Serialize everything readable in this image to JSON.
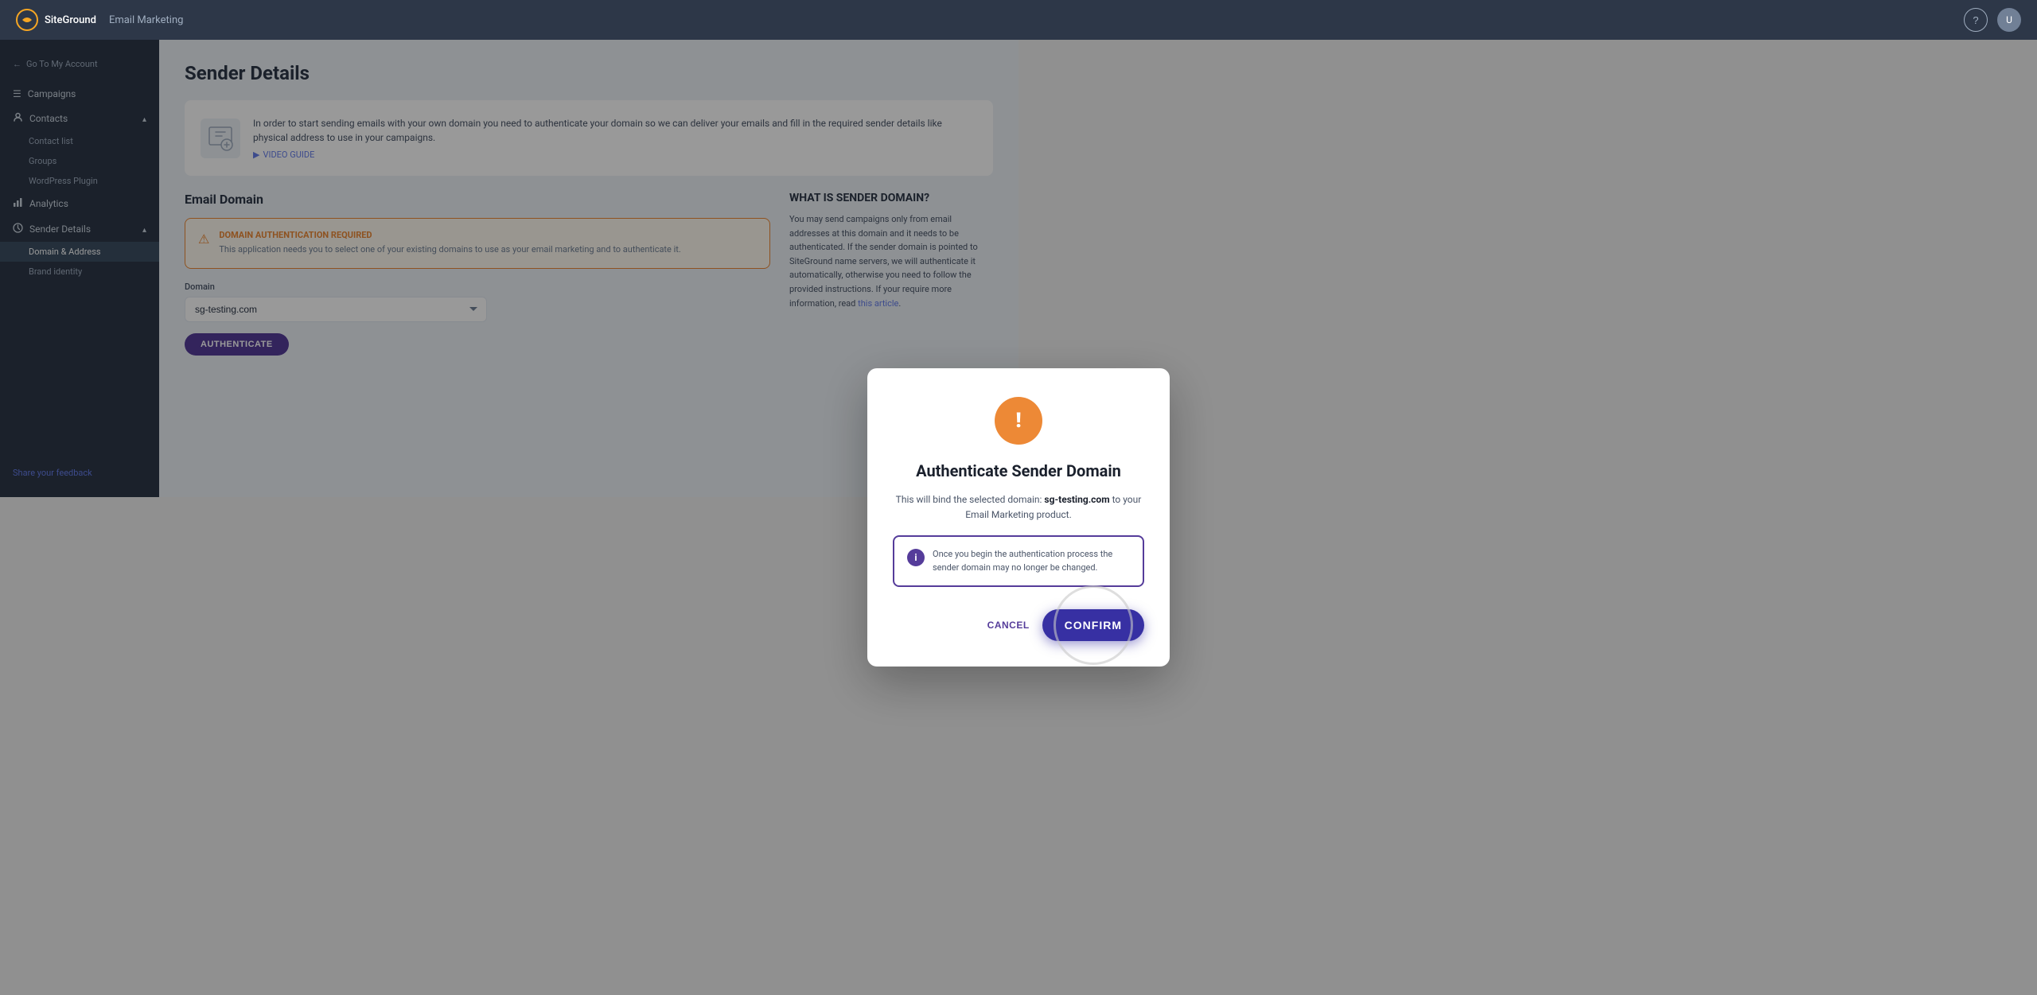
{
  "topnav": {
    "logo_text": "SiteGround",
    "product_title": "Email Marketing",
    "help_label": "?",
    "avatar_label": "U"
  },
  "sidebar": {
    "go_to_account": "Go To My Account",
    "items": [
      {
        "id": "campaigns",
        "label": "Campaigns",
        "icon": "campaigns-icon"
      },
      {
        "id": "contacts",
        "label": "Contacts",
        "icon": "contacts-icon",
        "expanded": true,
        "children": [
          {
            "id": "contact-list",
            "label": "Contact list"
          },
          {
            "id": "groups",
            "label": "Groups"
          },
          {
            "id": "wordpress-plugin",
            "label": "WordPress Plugin"
          }
        ]
      },
      {
        "id": "analytics",
        "label": "Analytics",
        "icon": "analytics-icon"
      },
      {
        "id": "sender-details",
        "label": "Sender Details",
        "icon": "sender-icon",
        "expanded": true,
        "children": [
          {
            "id": "domain-address",
            "label": "Domain & Address",
            "active": true
          },
          {
            "id": "brand-identity",
            "label": "Brand identity"
          }
        ]
      }
    ],
    "feedback": "Share your feedback"
  },
  "main": {
    "page_title": "Sender Details",
    "setup_text": "In order to start sending emails with your own domain you need to authenticate your domain so we can deliver your emails and fill in the required sender details like physical address to use in your campaigns.",
    "video_link": "VIDEO GUIDE",
    "email_domain_title": "Email Domain",
    "warning_title": "DOMAIN AUTHENTICATION REQUIRED",
    "warning_text": "This application needs you to select one of your existing domains to use as your email marketing and to authenticate it.",
    "form_label": "Domain",
    "form_value": "sg-testing.com",
    "btn_authenticate": "AUTHENTICATE",
    "right_panel": {
      "title": "WHAT IS SENDER DOMAIN?",
      "text": "You may send campaigns only from email addresses at this domain and it needs to be authenticated. If the sender domain is pointed to SiteGround name servers, we will authenticate it automatically, otherwise you need to follow the provided instructions. If your require more information, read",
      "link_text": "this article",
      "link_url": "#"
    }
  },
  "modal": {
    "title": "Authenticate Sender Domain",
    "desc_prefix": "This will bind the selected domain: ",
    "desc_domain": "sg-testing.com",
    "desc_suffix": " to your Email Marketing product.",
    "info_text": "Once you begin the authentication process the sender domain may no longer be changed.",
    "btn_cancel": "CANCEL",
    "btn_confirm": "CONFIRM"
  }
}
